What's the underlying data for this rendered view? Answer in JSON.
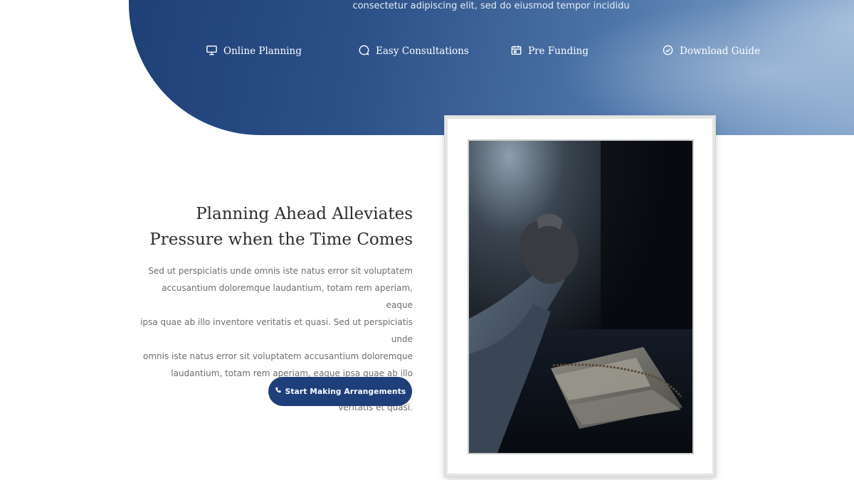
{
  "hero": {
    "tagline": "consectetur adipiscing elit, sed do eiusmod tempor incididu",
    "features": [
      {
        "label": "Online Planning",
        "icon": "monitor-icon"
      },
      {
        "label": "Easy Consultations",
        "icon": "chat-bubble-icon"
      },
      {
        "label": "Pre Funding",
        "icon": "calendar-icon"
      },
      {
        "label": "Download Guide",
        "icon": "check-circle-icon"
      }
    ]
  },
  "content": {
    "heading_line1": "Planning Ahead Alleviates",
    "heading_line2": "Pressure when the Time Comes",
    "body_lines": [
      "Sed ut perspiciatis unde omnis iste natus error sit voluptatem",
      "accusantium doloremque laudantium, totam rem aperiam, eaque",
      "ipsa quae ab illo inventore veritatis et quasi. Sed ut perspiciatis unde",
      "omnis iste natus error sit voluptatem accusantium doloremque",
      "laudantium, totam rem aperiam, eaque ipsa quae ab illo inventore",
      "veritatis et quasi."
    ],
    "cta_label": "Start Making Arrangements",
    "cta_icon": "phone-icon"
  },
  "photo": {
    "subject": "praying-hands-photo"
  },
  "colors": {
    "brand_blue": "#1f3f7a",
    "heading": "#2e2e2e",
    "body": "#6d6d6d"
  }
}
